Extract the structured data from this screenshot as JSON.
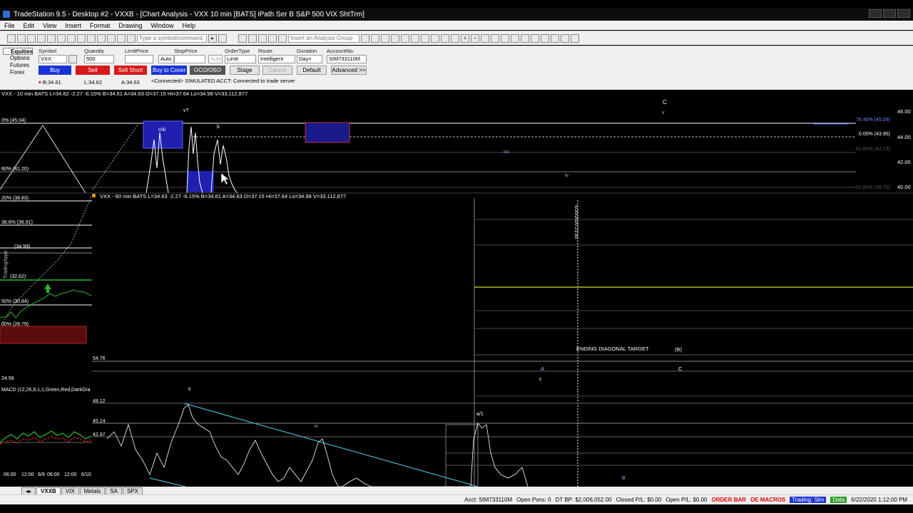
{
  "window": {
    "title": "TradeStation 9.5 - Desktop #2 - VXXB - [Chart Analysis - VXX 10 min [BATS] iPath Ser B S&P 500 VIX ShtTrm]"
  },
  "menu": [
    "File",
    "Edit",
    "View",
    "Insert",
    "Format",
    "Drawing",
    "Window",
    "Help"
  ],
  "toolbar": {
    "symbol_placeholder": "Type a symbol/command",
    "analysis_placeholder": "Insert an Analysis Group"
  },
  "order_bar": {
    "assets": [
      "Equities",
      "Options",
      "Futures",
      "Forex"
    ],
    "labels": {
      "symbol": "Symbol",
      "quantity": "Quantity",
      "limit": "LimitPrice",
      "stop": "StopPrice",
      "type": "OrderType",
      "route": "Route",
      "duration": "Duration",
      "account": "AccountNo."
    },
    "values": {
      "symbol": "VXX",
      "quantity": "500",
      "stop": "Auto",
      "stop2": "Auto",
      "type": "Limit",
      "route": "Intelligent",
      "duration": "Day+",
      "account": "SIM733110M"
    },
    "buttons": {
      "buy": "Buy",
      "sell": "Sell",
      "sell_short": "Sell Short",
      "buy_to_cover": "Buy to Cover",
      "oco": "OCO/OSO",
      "stage": "Stage",
      "cancel": "Cancel",
      "default": "Default",
      "advanced": "Advanced >>"
    },
    "quote": {
      "bid": "B:34.61",
      "last": "L:34.62",
      "ask": "A:34.63"
    },
    "status": "<Connected> SIMULATED ACCT: Connected to trade server"
  },
  "chart1": {
    "header": "VXX - 10 min  BATS  L=34.62 -2.27 -6.15%  B=34.61  A=34.63  O=37.15  Hi=37.64  Lo=34.98  V=33,112,877",
    "price_labels": [
      "46.00",
      "44.00",
      "42.00",
      "40.00"
    ],
    "fib_labels": [
      "76.40% (45.09)",
      "0.00% (43.95)",
      "61.80% (42.73)",
      "61.80% (39.70)"
    ],
    "left_labels": [
      "0% (45.04)",
      "60% (41.20)"
    ],
    "wave_labels": [
      "c/iii",
      "b",
      "v?",
      "iii/c",
      "iv",
      "C",
      "v"
    ]
  },
  "chart2": {
    "header": "VXX - 60 min  BATS  L=34.63 -2.27 -6.15%  B=34.61  A=34.63  O=37.15  Hi=37.64  Lo=34.98  V=33,112,877",
    "left_labels": [
      "20% (38.83)",
      "38.6% (36.91)",
      "(34.99)",
      "(32.62)",
      "50% (30.84)",
      "00% (28.79)",
      "24.58"
    ],
    "price_labels": [
      "54.76",
      "48.12",
      "45.14",
      "42.97"
    ],
    "date_label": "6/20/2020 21:00",
    "annotation": "ENDING DIAGONAL TARGET",
    "wave_labels": [
      "(B)",
      "A",
      "c",
      "C",
      "ii",
      "iv",
      "a/1",
      "B"
    ]
  },
  "macd": {
    "label": "MACD (12,26,9,1,1,Green,Red,DarkGra",
    "time_ticks": [
      "06:00",
      "12:00",
      "6/9",
      "06:00",
      "12:00",
      "6/10"
    ]
  },
  "sidebar_text": "TradingApps",
  "tabs": [
    "VXXB",
    "VIX",
    "Metals",
    "SA",
    "SPX"
  ],
  "statusbar": {
    "acct": "Acct: SIM733110M",
    "open_psns": "Open Psns: 0",
    "dt_bp": "DT BP: $2,006,052.00",
    "closed_pl": "Closed P/L: $0.00",
    "open_pl": "Open P/L: $0.00",
    "order_bar": "ORDER BAR",
    "oe_macros": "OE MACROS",
    "trading": "Trading: Sim",
    "data": "Data",
    "datetime": "6/22/2020 1:12:00 PM"
  },
  "colors": {
    "buy": "#1a33d6",
    "sell": "#d61a1a",
    "chart_bg": "#000000",
    "price_line": "#ffffff",
    "trendline": "#3fb5c8",
    "target_line": "#b6b62a"
  }
}
